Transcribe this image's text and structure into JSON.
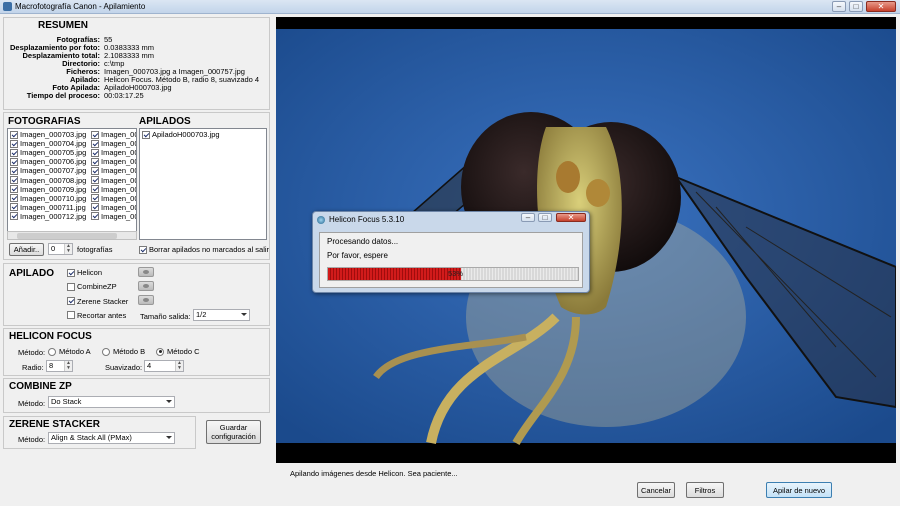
{
  "window": {
    "title": "Macrofotografía Canon - Apilamiento"
  },
  "resumen": {
    "heading": "RESUMEN",
    "rows": [
      {
        "label": "Fotografías:",
        "value": "55"
      },
      {
        "label": "Desplazamiento por foto:",
        "value": "0.0383333 mm"
      },
      {
        "label": "Desplazamiento total:",
        "value": "2.1083333 mm"
      },
      {
        "label": "Directorio:",
        "value": "c:\\tmp"
      },
      {
        "label": "Ficheros:",
        "value": "Imagen_000703.jpg a Imagen_000757.jpg"
      },
      {
        "label": "Apilado:",
        "value": "Helicon Focus. Método B, radio 8, suavizado 4"
      },
      {
        "label": "Foto Apilada:",
        "value": "ApiladoH000703.jpg"
      },
      {
        "label": "Tiempo del proceso:",
        "value": "00:03:17.25"
      }
    ]
  },
  "fotografias": {
    "heading": "FOTOGRAFIAS",
    "col1": [
      "Imagen_000703.jpg",
      "Imagen_000704.jpg",
      "Imagen_000705.jpg",
      "Imagen_000706.jpg",
      "Imagen_000707.jpg",
      "Imagen_000708.jpg",
      "Imagen_000709.jpg",
      "Imagen_000710.jpg",
      "Imagen_000711.jpg",
      "Imagen_000712.jpg"
    ],
    "col2": [
      "Imagen_00",
      "Imagen_00",
      "Imagen_00",
      "Imagen_00",
      "Imagen_00",
      "Imagen_00",
      "Imagen_00",
      "Imagen_00",
      "Imagen_00",
      "Imagen_00"
    ],
    "add_button": "Añadir..",
    "count_value": "0",
    "count_label": "fotografías"
  },
  "apilados": {
    "heading": "APILADOS",
    "items": [
      "ApiladoH000703.jpg"
    ],
    "delete_checkbox_label": "Borrar apilados no marcados al salir"
  },
  "apilado": {
    "heading": "APILADO",
    "options": [
      {
        "label": "Helicon",
        "checked": true
      },
      {
        "label": "CombineZP",
        "checked": false
      },
      {
        "label": "Zerene Stacker",
        "checked": true
      },
      {
        "label": "Recortar antes",
        "checked": false
      }
    ],
    "size_label": "Tamaño salida:",
    "size_value": "1/2"
  },
  "helicon": {
    "heading": "HELICON FOCUS",
    "method_label": "Método:",
    "methods": [
      "Método A",
      "Método B",
      "Método C"
    ],
    "selected_method": "Método C",
    "radio_label": "Radio:",
    "radio_value": "8",
    "smooth_label": "Suavizado:",
    "smooth_value": "4"
  },
  "combinezp": {
    "heading": "COMBINE ZP",
    "method_label": "Método:",
    "method_value": "Do Stack"
  },
  "zerene": {
    "heading": "ZERENE STACKER",
    "method_label": "Método:",
    "method_value": "Align & Stack All (PMax)"
  },
  "save_button": "Guardar configuración",
  "dialog": {
    "title": "Helicon Focus 5.3.10",
    "line1": "Procesando datos...",
    "line2": "Por favor, espere",
    "progress_percent": 53,
    "progress_text": "53%"
  },
  "status_text": "Apilando imágenes desde Helicon. Sea paciente...",
  "footer": {
    "cancel": "Cancelar",
    "filters": "Filtros",
    "restack": "Apilar de nuevo"
  },
  "colors": {
    "accent": "#3c7fb1",
    "progress": "#d21b1b",
    "background": "#2a5fa8"
  }
}
